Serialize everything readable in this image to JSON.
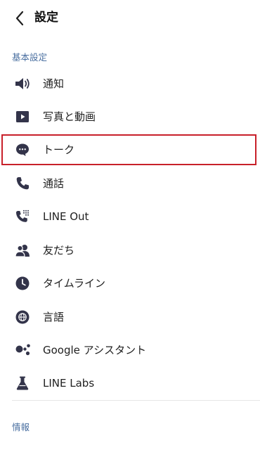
{
  "header": {
    "title": "設定"
  },
  "sections": {
    "basic": {
      "label": "基本設定"
    },
    "info": {
      "label": "情報"
    }
  },
  "items": [
    {
      "label": "通知",
      "icon": "speaker-icon"
    },
    {
      "label": "写真と動画",
      "icon": "play-video-icon"
    },
    {
      "label": "トーク",
      "icon": "chat-bubble-icon"
    },
    {
      "label": "通話",
      "icon": "phone-icon"
    },
    {
      "label": "LINE Out",
      "icon": "phone-dialpad-icon"
    },
    {
      "label": "友だち",
      "icon": "friends-icon"
    },
    {
      "label": "タイムライン",
      "icon": "clock-icon"
    },
    {
      "label": "言語",
      "icon": "globe-icon"
    },
    {
      "label": "Google アシスタント",
      "icon": "google-assistant-icon"
    },
    {
      "label": "LINE Labs",
      "icon": "flask-icon"
    }
  ],
  "colors": {
    "icon": "#33344a",
    "section_label": "#4a6fa0",
    "highlight_border": "#c8202a"
  }
}
